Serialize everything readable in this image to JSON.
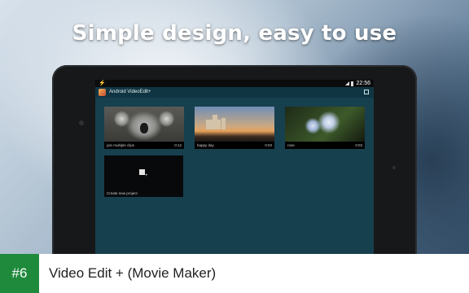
{
  "headline": "Simple design, easy to use",
  "device": {
    "status_bar": {
      "time": "22:56"
    },
    "action_bar": {
      "title": "Android VideoEdit+"
    },
    "clips": [
      {
        "name": "join multiple clips",
        "duration": "0:12",
        "thumb": "koala"
      },
      {
        "name": "happy day",
        "duration": "0:03",
        "thumb": "castle"
      },
      {
        "name": "rose",
        "duration": "0:03",
        "thumb": "flower"
      }
    ],
    "new_project_label": "Create new project"
  },
  "footer": {
    "rank": "#6",
    "app_name": "Video Edit + (Movie Maker)"
  },
  "colors": {
    "rank_badge": "#1f8a3c",
    "screen_bg": "#17404f"
  }
}
